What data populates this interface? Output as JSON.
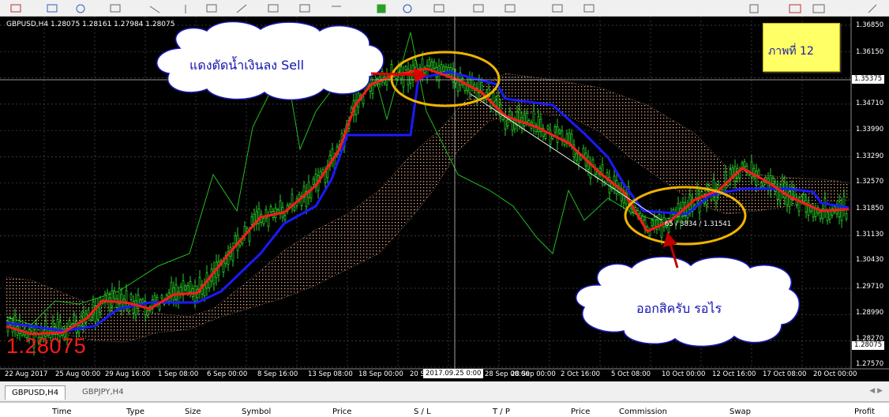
{
  "chart": {
    "title": "GBPUSD,H4  1.28075 1.28161 1.27984 1.28075",
    "current_price": "1.28075",
    "y_labels": [
      "1.36850",
      "1.36150",
      "1.35375",
      "1.34710",
      "1.33990",
      "1.33290",
      "1.32570",
      "1.31850",
      "1.31130",
      "1.30430",
      "1.29710",
      "1.28990",
      "1.28270",
      "1.28075",
      "1.27570"
    ],
    "x_labels": [
      "22 Aug 2017",
      "25 Aug 00:00",
      "29 Aug 16:00",
      "1 Sep 08:00",
      "6 Sep 00:00",
      "8 Sep 16:00",
      "13 Sep 08:00",
      "18 Sep 00:00",
      "20 S",
      "28 Sep 00:00",
      "2 Oct 16:00",
      "5 Oct 08:00",
      "10 Oct 00:00",
      "12 Oct 16:00",
      "17 Oct 08:00",
      "20 Oct 00:00"
    ],
    "cursor_time": "2017.09.25 0:00",
    "trendline_label": "65 / 3834 / 1.31541"
  },
  "annotations": {
    "note": "ภาพที่ 12",
    "cloud_top": "แดงตัดน้ำเงินลง  Sell",
    "cloud_bottom": "ออกสิครับ รอไร"
  },
  "colors": {
    "background": "#000000",
    "candles": "#33ff33",
    "tenkan": "#ff1a1a",
    "kijun": "#1a1aff",
    "chikou": "#22bb22",
    "cloud": "#e8a882",
    "ellipse": "#f0b400",
    "note_bg": "#ffff66"
  },
  "tabs": [
    "GBPUSD,H4",
    "GBPJPY,H4"
  ],
  "terminal": {
    "columns": [
      "Time",
      "Type",
      "Size",
      "Symbol",
      "Price",
      "S / L",
      "T / P",
      "Price",
      "Commission",
      "Swap",
      "Profit"
    ]
  }
}
